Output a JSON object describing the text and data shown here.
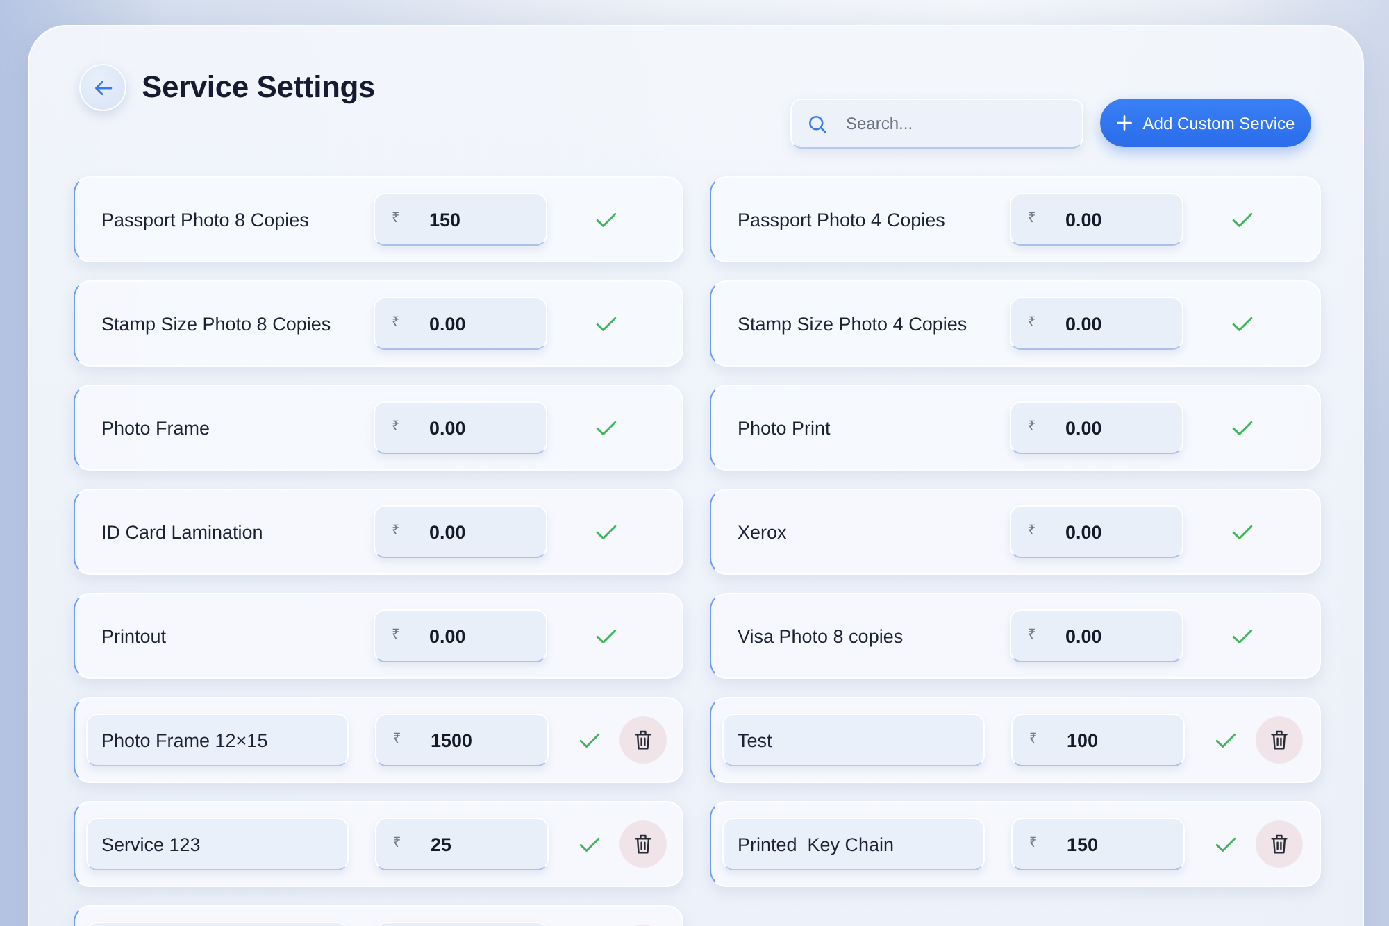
{
  "header": {
    "title": "Service Settings"
  },
  "search": {
    "placeholder": "Search..."
  },
  "add_button": {
    "label": "Add Custom Service"
  },
  "services": [
    {
      "kind": "standard",
      "name": "Passport Photo 8 Copies",
      "currency": "₹",
      "price": "150"
    },
    {
      "kind": "standard",
      "name": "Passport Photo 4 Copies",
      "currency": "₹",
      "price": "0.00"
    },
    {
      "kind": "standard",
      "name": "Stamp Size Photo 8 Copies",
      "currency": "₹",
      "price": "0.00"
    },
    {
      "kind": "standard",
      "name": "Stamp Size Photo 4 Copies",
      "currency": "₹",
      "price": "0.00"
    },
    {
      "kind": "standard",
      "name": "Photo Frame",
      "currency": "₹",
      "price": "0.00"
    },
    {
      "kind": "standard",
      "name": "Photo Print",
      "currency": "₹",
      "price": "0.00"
    },
    {
      "kind": "standard",
      "name": "ID Card Lamination",
      "currency": "₹",
      "price": "0.00"
    },
    {
      "kind": "standard",
      "name": "Xerox",
      "currency": "₹",
      "price": "0.00"
    },
    {
      "kind": "standard",
      "name": "Printout",
      "currency": "₹",
      "price": "0.00"
    },
    {
      "kind": "standard",
      "name": "Visa Photo 8 copies",
      "currency": "₹",
      "price": "0.00"
    },
    {
      "kind": "custom",
      "name": "Photo Frame 12×15",
      "currency": "₹",
      "price": "1500"
    },
    {
      "kind": "custom",
      "name": "Test",
      "currency": "₹",
      "price": "100"
    },
    {
      "kind": "custom",
      "name": "Service 123",
      "currency": "₹",
      "price": "25"
    },
    {
      "kind": "custom",
      "name": "Printed  Key Chain",
      "currency": "₹",
      "price": "150"
    },
    {
      "kind": "custom"
    }
  ]
}
